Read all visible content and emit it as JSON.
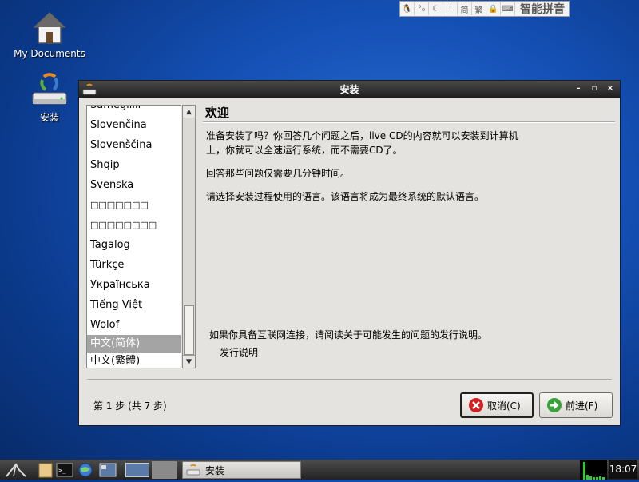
{
  "desktop": {
    "icons": [
      {
        "label": "My Documents",
        "icon": "home-folder-icon"
      },
      {
        "label": "安装",
        "icon": "install-icon"
      }
    ]
  },
  "ime_bar": {
    "segments": [
      "tux-icon",
      "punctuation-icon",
      "moon-icon",
      "fullwidth-icon",
      "simplified-icon",
      "traditional-icon",
      "lock-icon",
      "keyboard-icon"
    ],
    "name": "智能拼音"
  },
  "window": {
    "title": "安装",
    "controls": {
      "minimize": "–",
      "maximize": "▫",
      "close": "×"
    }
  },
  "language_list": {
    "items": [
      "Sámegillii",
      "Slovenčina",
      "Slovenščina",
      "Shqip",
      "Svenska",
      "□□□□□□□",
      "□□□□□□□□",
      "Tagalog",
      "Türkçe",
      "Українська",
      "Tiếng Việt",
      "Wolof",
      "中文(简体)",
      "中文(繁體)"
    ],
    "selected": "中文(简体)"
  },
  "content": {
    "heading": "欢迎",
    "p1": "准备安装了吗？你回答几个问题之后，live CD的内容就可以安装到计算机上，你就可以全速运行系统，而不需要CD了。",
    "p2": "回答那些问题仅需要几分钟时间。",
    "p3": "请选择安装过程使用的语言。该语言将成为最终系统的默认语言。",
    "p4": "如果你具备互联网连接，请阅读关于可能发生的问题的发行说明。",
    "release_notes_link": "发行说明"
  },
  "footer": {
    "step": "第 1 步 (共 7 步)",
    "cancel_label": "取消(C)",
    "next_label": "前进(F)"
  },
  "taskbar": {
    "task_label": "安装",
    "clock": "18:07"
  },
  "colors": {
    "desktop_blue": "#1551b6",
    "selection_gray": "#a4a4a4",
    "cancel_red": "#d42020",
    "next_green": "#3aa23a"
  }
}
